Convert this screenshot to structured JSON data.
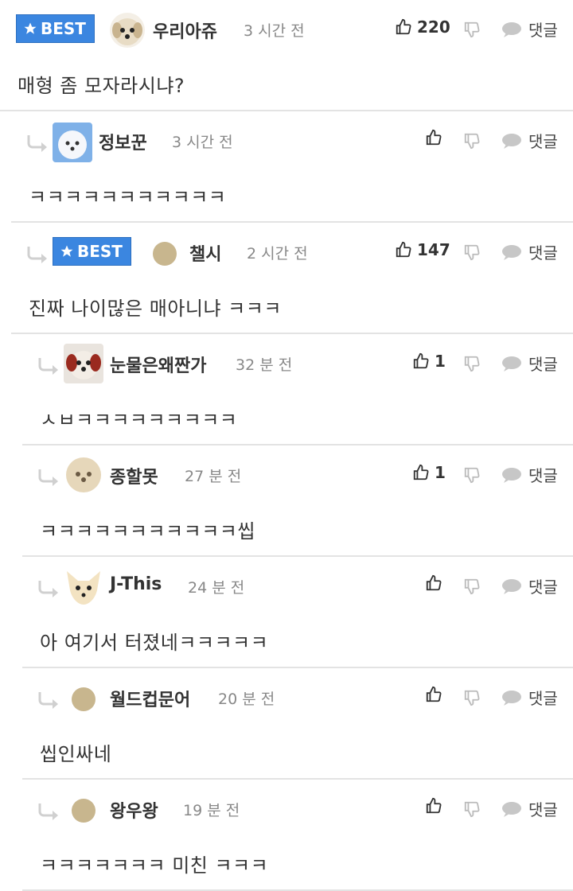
{
  "labels": {
    "best": "BEST",
    "reply": "댓글"
  },
  "colors": {
    "best_bg": "#3b86e0",
    "separator": "#e3e3e3",
    "text": "#333333",
    "meta": "#888888"
  },
  "comments": [
    {
      "nick": "우리아쥬",
      "time": "3 시간 전",
      "likes": "220",
      "best": true,
      "depth": 0,
      "text": "매형 좀 모자라시냐?",
      "avatar": "puppy-avatar"
    },
    {
      "nick": "정보꾼",
      "time": "3 시간 전",
      "likes": "",
      "best": false,
      "depth": 1,
      "text": "ㅋㅋㅋㅋㅋㅋㅋㅋㅋㅋㅋ",
      "avatar": "white-dog-avatar"
    },
    {
      "nick": "챌시",
      "time": "2 시간 전",
      "likes": "147",
      "best": true,
      "depth": 1,
      "text": "진짜 나이많은 매아니냐 ㅋㅋㅋ",
      "avatar": "default-avatar"
    },
    {
      "nick": "눈물은왜짠가",
      "time": "32 분 전",
      "likes": "1",
      "best": false,
      "depth": 2,
      "text": "ㅅㅂㅋㅋㅋㅋㅋㅋㅋㅋㅋ",
      "avatar": "red-dog-avatar"
    },
    {
      "nick": "종할못",
      "time": "27 분 전",
      "likes": "1",
      "best": false,
      "depth": 2,
      "text": "ㅋㅋㅋㅋㅋㅋㅋㅋㅋㅋㅋ씹",
      "avatar": "fluffy-dog-avatar"
    },
    {
      "nick": "J-This",
      "time": "24 분 전",
      "likes": "",
      "best": false,
      "depth": 2,
      "text": "아 여기서 터졌네ㅋㅋㅋㅋㅋ",
      "avatar": "chihuahua-avatar"
    },
    {
      "nick": "월드컵문어",
      "time": "20 분 전",
      "likes": "",
      "best": false,
      "depth": 2,
      "text": "씹인싸네",
      "avatar": "default-avatar"
    },
    {
      "nick": "왕우왕",
      "time": "19 분 전",
      "likes": "",
      "best": false,
      "depth": 2,
      "text": "ㅋㅋㅋㅋㅋㅋㅋ 미친 ㅋㅋㅋ",
      "avatar": "default-avatar"
    }
  ]
}
